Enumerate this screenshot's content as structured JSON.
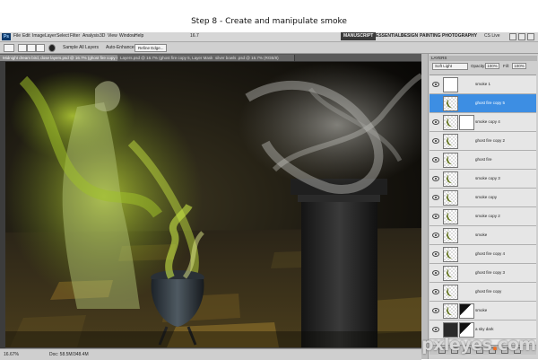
{
  "caption": {
    "title": "Step 8 - Create and manipulate smoke"
  },
  "app": {
    "logo": "Ps",
    "menu": [
      "File",
      "Edit",
      "Image",
      "Layer",
      "Select",
      "Filter",
      "Analysis",
      "3D",
      "View",
      "Window",
      "Help"
    ],
    "zoom": "16.7",
    "workspaces": [
      "MANUSCRIPT",
      "ESSENTIALS",
      "DESIGN",
      "PAINTING",
      "PHOTOGRAPHY"
    ],
    "active_workspace": "MANUSCRIPT",
    "cs_live": "CS Live"
  },
  "options": {
    "mode_label": "Sample All Layers",
    "auto_enhance": "Auto-Enhance",
    "refine_edge": "Refine Edge..."
  },
  "tabs": [
    "Midnight dream bird, dose layers.psd @ 16.7% (ghost fire copy 5, RGB/8) *",
    "Layers.psd @ 16.7% (ghost fire copy 5, Layer Mask/8)",
    "silver bowls .psd @ 16.7% (RGB/8)"
  ],
  "status": {
    "zoom": "16.67%",
    "doc": "Doc: 58.5M/348.4M"
  },
  "layers_panel": {
    "title": "LAYERS",
    "blend_mode": "Soft Light",
    "opacity_label": "Opacity:",
    "opacity": "100%",
    "fill_label": "Fill:",
    "fill": "100%",
    "layers": [
      {
        "name": "smoke 1",
        "type": "group"
      },
      {
        "name": "ghost fire copy 5",
        "selected": true
      },
      {
        "name": "smoke copy 4",
        "mask": true
      },
      {
        "name": "ghost fire copy 2"
      },
      {
        "name": "ghost fire"
      },
      {
        "name": "smoke copy 3"
      },
      {
        "name": "smoke copy"
      },
      {
        "name": "smoke copy 2"
      },
      {
        "name": "smoke"
      },
      {
        "name": "ghost fire copy 4"
      },
      {
        "name": "ghost fire copy 3"
      },
      {
        "name": "ghost fire copy"
      },
      {
        "name": "smoke",
        "mask": true
      },
      {
        "name": "a sky dark",
        "mask": true,
        "dark": true
      }
    ]
  },
  "watermark": {
    "text": "pxleyes",
    "dot": ".",
    "tld": "com"
  }
}
